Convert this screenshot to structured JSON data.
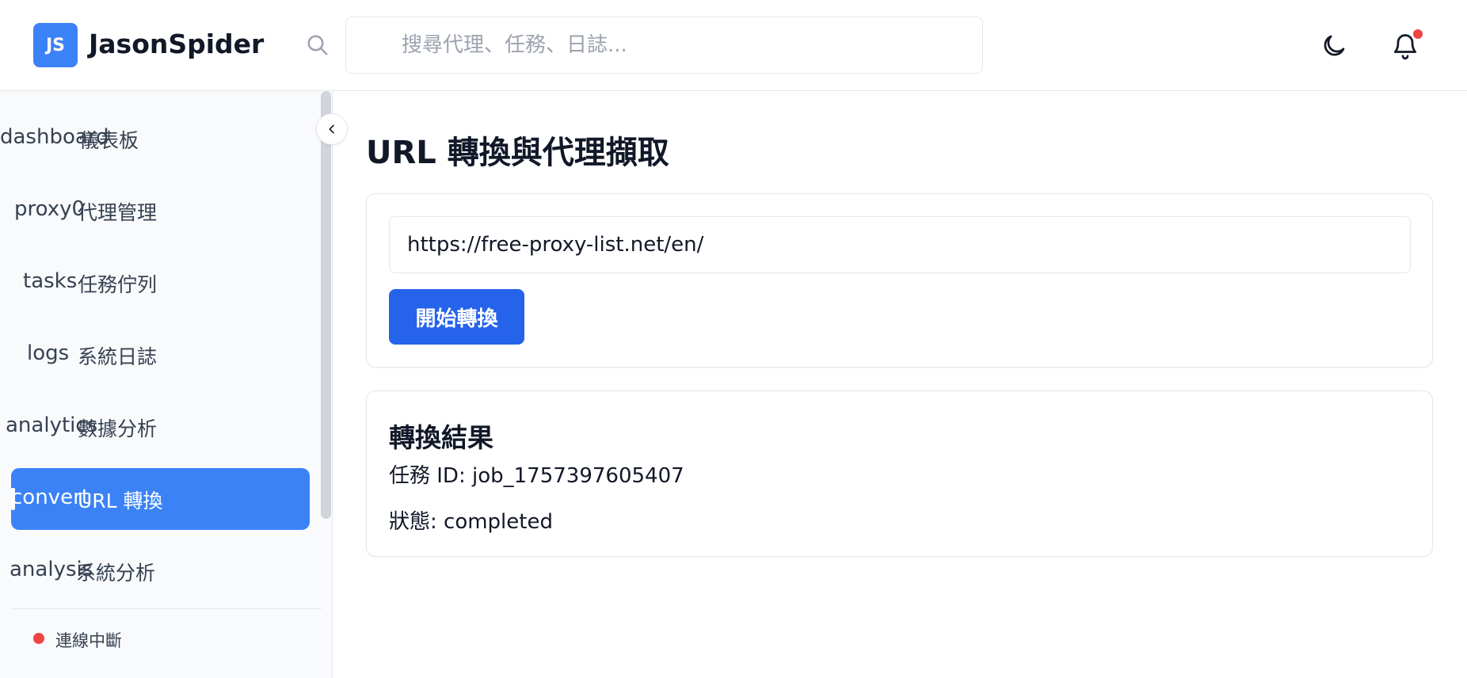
{
  "header": {
    "logo_text": "JS",
    "app_name": "JasonSpider",
    "search_placeholder": "搜尋代理、任務、日誌..."
  },
  "sidebar": {
    "items": [
      {
        "code": "dashboard",
        "label": "儀表板",
        "active": false
      },
      {
        "code": "proxy0",
        "label": "代理管理",
        "active": false
      },
      {
        "code": "tasks",
        "label": "任務佇列",
        "active": false
      },
      {
        "code": "logs",
        "label": "系統日誌",
        "active": false
      },
      {
        "code": "analytics",
        "label": "數據分析",
        "active": false
      },
      {
        "code": "convert",
        "label": "URL 轉換",
        "active": true
      },
      {
        "code": "analysis",
        "label": "系統分析",
        "active": false
      }
    ],
    "status_text": "連線中斷"
  },
  "main": {
    "title": "URL 轉換與代理擷取",
    "url_value": "https://free-proxy-list.net/en/",
    "convert_label": "開始轉換",
    "result": {
      "title": "轉換結果",
      "task_id_line": "任務 ID: job_1757397605407",
      "status_line": "狀態: completed"
    }
  },
  "colors": {
    "accent": "#3b82f6",
    "button": "#2563eb",
    "status_error": "#ef4444"
  }
}
